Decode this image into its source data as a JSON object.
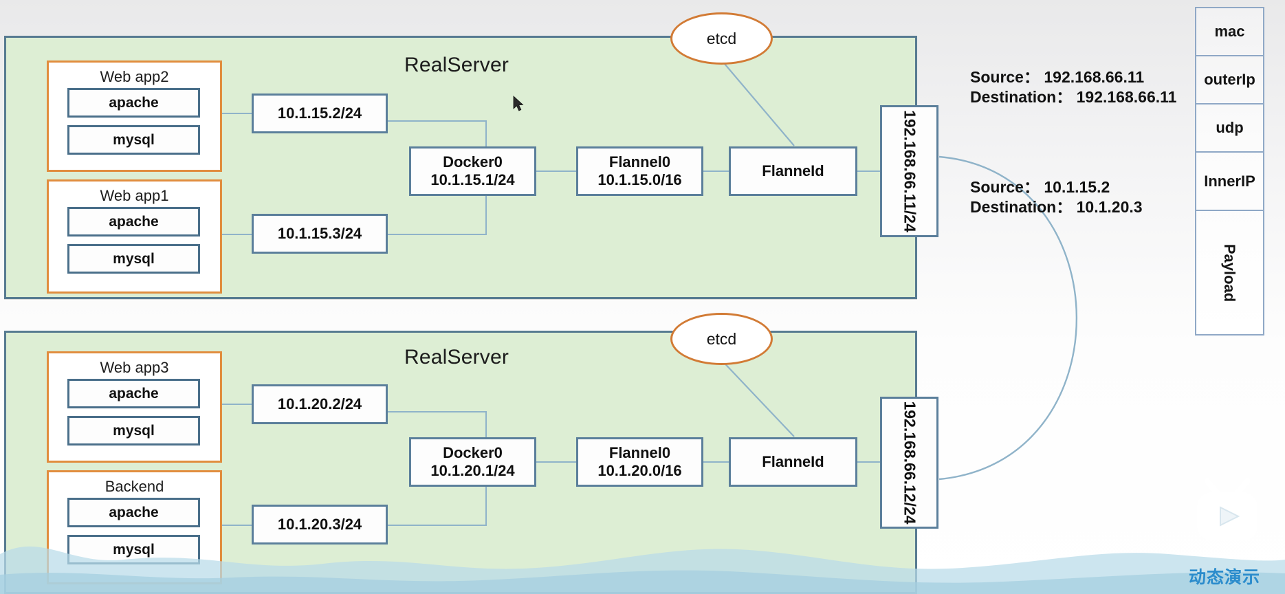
{
  "diagram": {
    "title_top": "RealServer",
    "title_bottom": "RealServer",
    "etcd_top_label": "etcd",
    "etcd_bottom_label": "etcd"
  },
  "realserver_top": {
    "name": "RealServer",
    "apps": [
      {
        "title": "Web app2",
        "services": [
          "apache",
          "mysql"
        ],
        "ip": "10.1.15.2/24"
      },
      {
        "title": "Web app1",
        "services": [
          "apache",
          "mysql"
        ],
        "ip": "10.1.15.3/24"
      }
    ],
    "docker": {
      "name": "Docker0",
      "cidr": "10.1.15.1/24"
    },
    "flannel0": {
      "name": "Flannel0",
      "cidr": "10.1.15.0/16"
    },
    "flanneld": {
      "name": "FlanneId"
    },
    "host_ip": "192.168.66.11/24"
  },
  "realserver_bottom": {
    "name": "RealServer",
    "apps": [
      {
        "title": "Web app3",
        "services": [
          "apache",
          "mysql"
        ],
        "ip": "10.1.20.2/24"
      },
      {
        "title": "Backend",
        "services": [
          "apache",
          "mysql"
        ],
        "ip": "10.1.20.3/24"
      }
    ],
    "docker": {
      "name": "Docker0",
      "cidr": "10.1.20.1/24"
    },
    "flannel0": {
      "name": "Flannel0",
      "cidr": "10.1.20.0/16"
    },
    "flanneld": {
      "name": "FlanneId"
    },
    "host_ip": "192.168.66.12/24"
  },
  "annotations": {
    "outer": {
      "source": "Source： 192.168.66.11",
      "destination": "Destination： 192.168.66.11"
    },
    "inner": {
      "source": "Source： 10.1.15.2",
      "destination": "Destination： 10.1.20.3"
    }
  },
  "packet_stack": {
    "layers": [
      "mac",
      "outerIp",
      "udp",
      "InnerIP",
      "Payload"
    ]
  },
  "watermark": {
    "text": "动态演示",
    "logo": "bilibili-tv-logo"
  },
  "colors": {
    "panel_fill": "#ddeed4",
    "panel_border": "#577b91",
    "app_border": "#e18d3e",
    "node_border": "#5b7f9b",
    "connector": "#8fb3c9",
    "etcd_border": "#d27b35",
    "packet_border": "#8fa8c6",
    "watermark_text": "#2b8ccc",
    "wave": "#b9dbe8"
  }
}
